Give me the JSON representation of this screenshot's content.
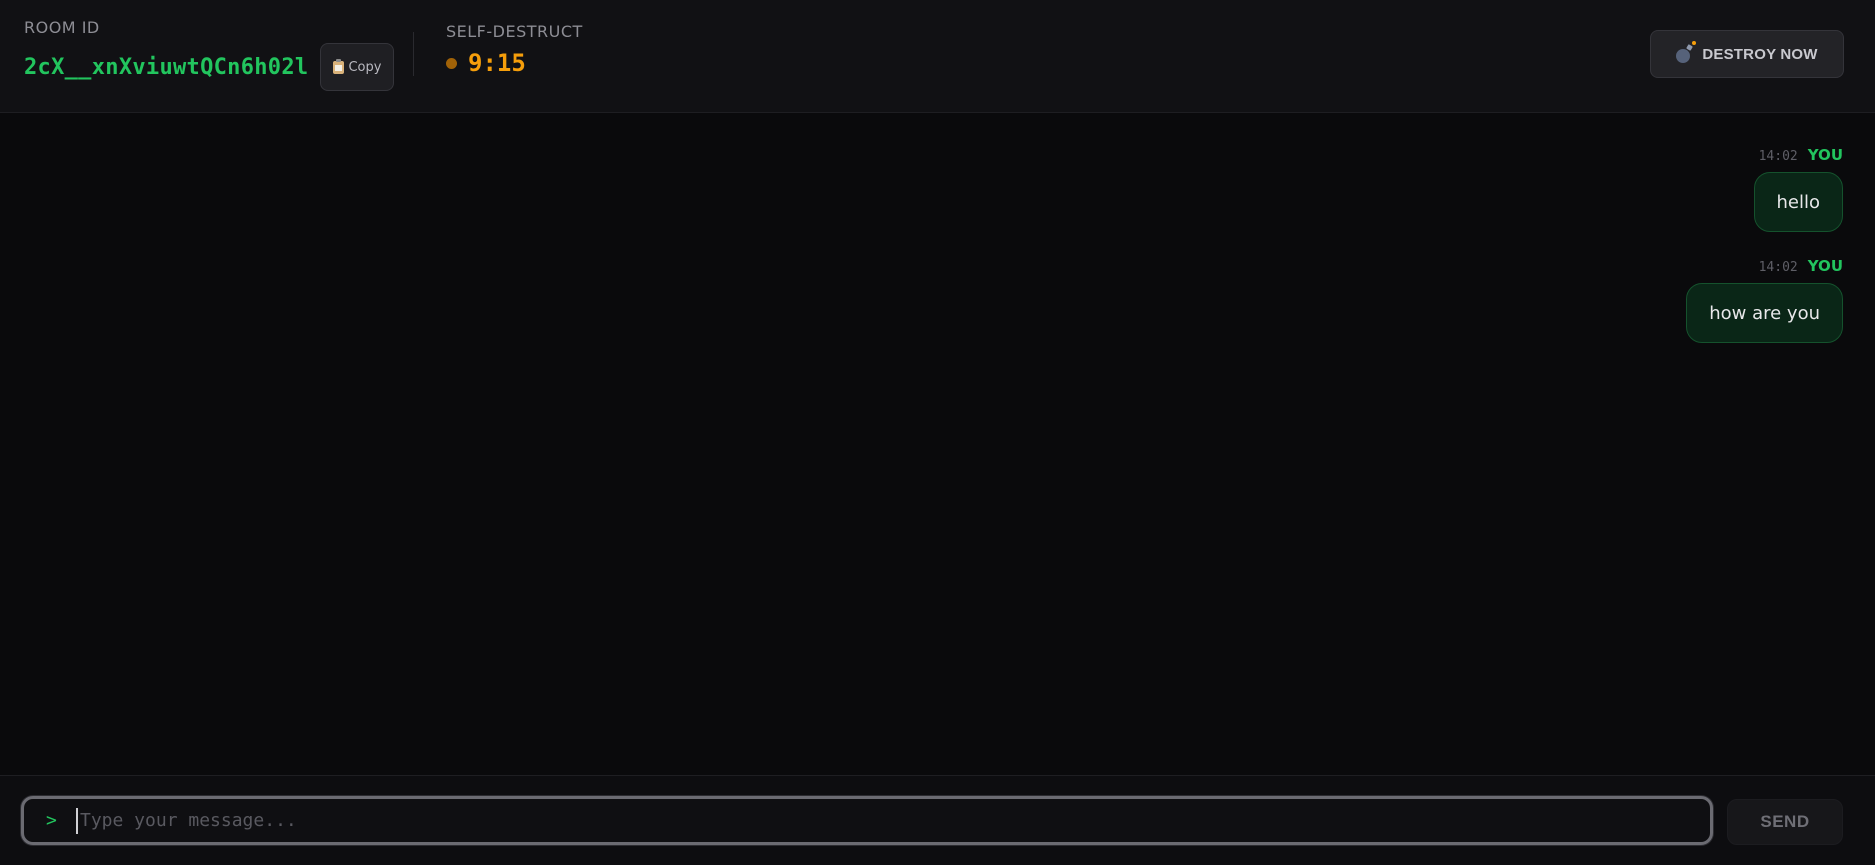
{
  "header": {
    "room_label": "ROOM ID",
    "room_id": "2cX__xnXviuwtQCn6h02l",
    "copy_label": "Copy",
    "self_destruct_label": "SELF-DESTRUCT",
    "timer": "9:15",
    "destroy_label": "DESTROY NOW"
  },
  "messages": [
    {
      "time": "14:02",
      "sender": "YOU",
      "text": "hello"
    },
    {
      "time": "14:02",
      "sender": "YOU",
      "text": "how are you"
    }
  ],
  "composer": {
    "prompt": ">",
    "placeholder": "Type your message...",
    "value": "",
    "send_label": "SEND"
  },
  "icons": {
    "copy": "clipboard-icon",
    "destroy": "bomb-icon",
    "timer": "status-dot-icon"
  },
  "colors": {
    "accent_green": "#22c55e",
    "timer_amber": "#f59e0b",
    "background": "#0a0a0c",
    "bubble_bg": "#0a2617"
  }
}
